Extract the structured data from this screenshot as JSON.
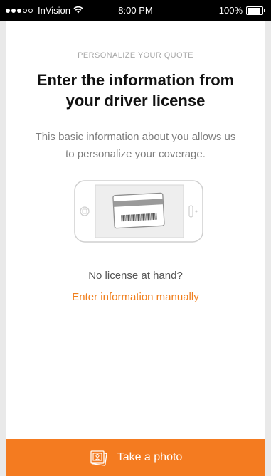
{
  "status_bar": {
    "carrier": "InVision",
    "time": "8:00 PM",
    "battery": "100%",
    "battery_level": 1.0
  },
  "screen": {
    "eyebrow": "PERSONALIZE YOUR QUOTE",
    "title": "Enter the information from your driver license",
    "description": "This basic information about you allows us to personalize your coverage.",
    "no_license_text": "No license at hand?",
    "manual_link": "Enter information manually",
    "illustration_icon": "phone-scanning-license-icon"
  },
  "bottom_button": {
    "label": "Take a photo",
    "icon": "photos-icon"
  },
  "colors": {
    "accent": "#f47b20",
    "link": "#f07e1c",
    "title": "#111111",
    "muted": "#a8a8a8"
  }
}
